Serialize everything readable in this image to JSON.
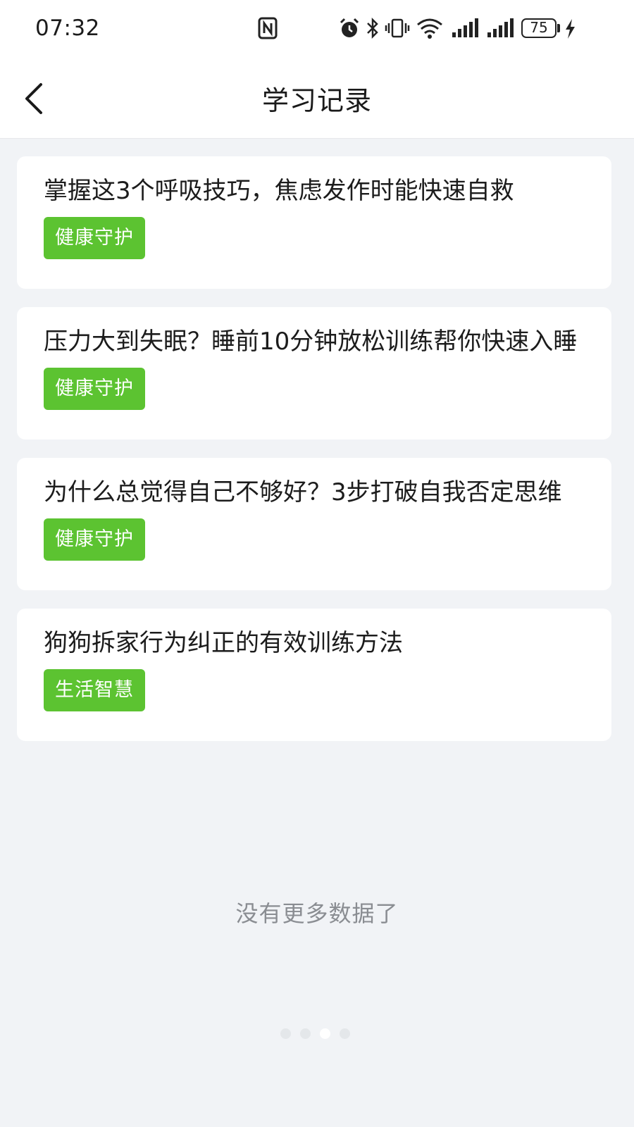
{
  "status_bar": {
    "time": "07:32",
    "battery_level": "75",
    "icons": [
      "nfc-icon",
      "alarm-icon",
      "bluetooth-icon",
      "vibrate-icon",
      "wifi-icon",
      "signal-icon",
      "signal-icon",
      "battery-icon",
      "charging-icon"
    ]
  },
  "header": {
    "back_icon": "chevron-left-icon",
    "title": "学习记录"
  },
  "records": [
    {
      "title": "掌握这3个呼吸技巧，焦虑发作时能快速自救",
      "tag": "健康守护"
    },
    {
      "title": "压力大到失眠？睡前10分钟放松训练帮你快速入睡",
      "tag": "健康守护"
    },
    {
      "title": "为什么总觉得自己不够好？3步打破自我否定思维",
      "tag": "健康守护"
    },
    {
      "title": "狗狗拆家行为纠正的有效训练方法",
      "tag": "生活智慧"
    }
  ],
  "footer": {
    "end_text": "没有更多数据了"
  },
  "pager": {
    "count": 4,
    "active_index": 2
  },
  "colors": {
    "tag_green": "#5cc331",
    "page_background": "#f1f3f6"
  }
}
